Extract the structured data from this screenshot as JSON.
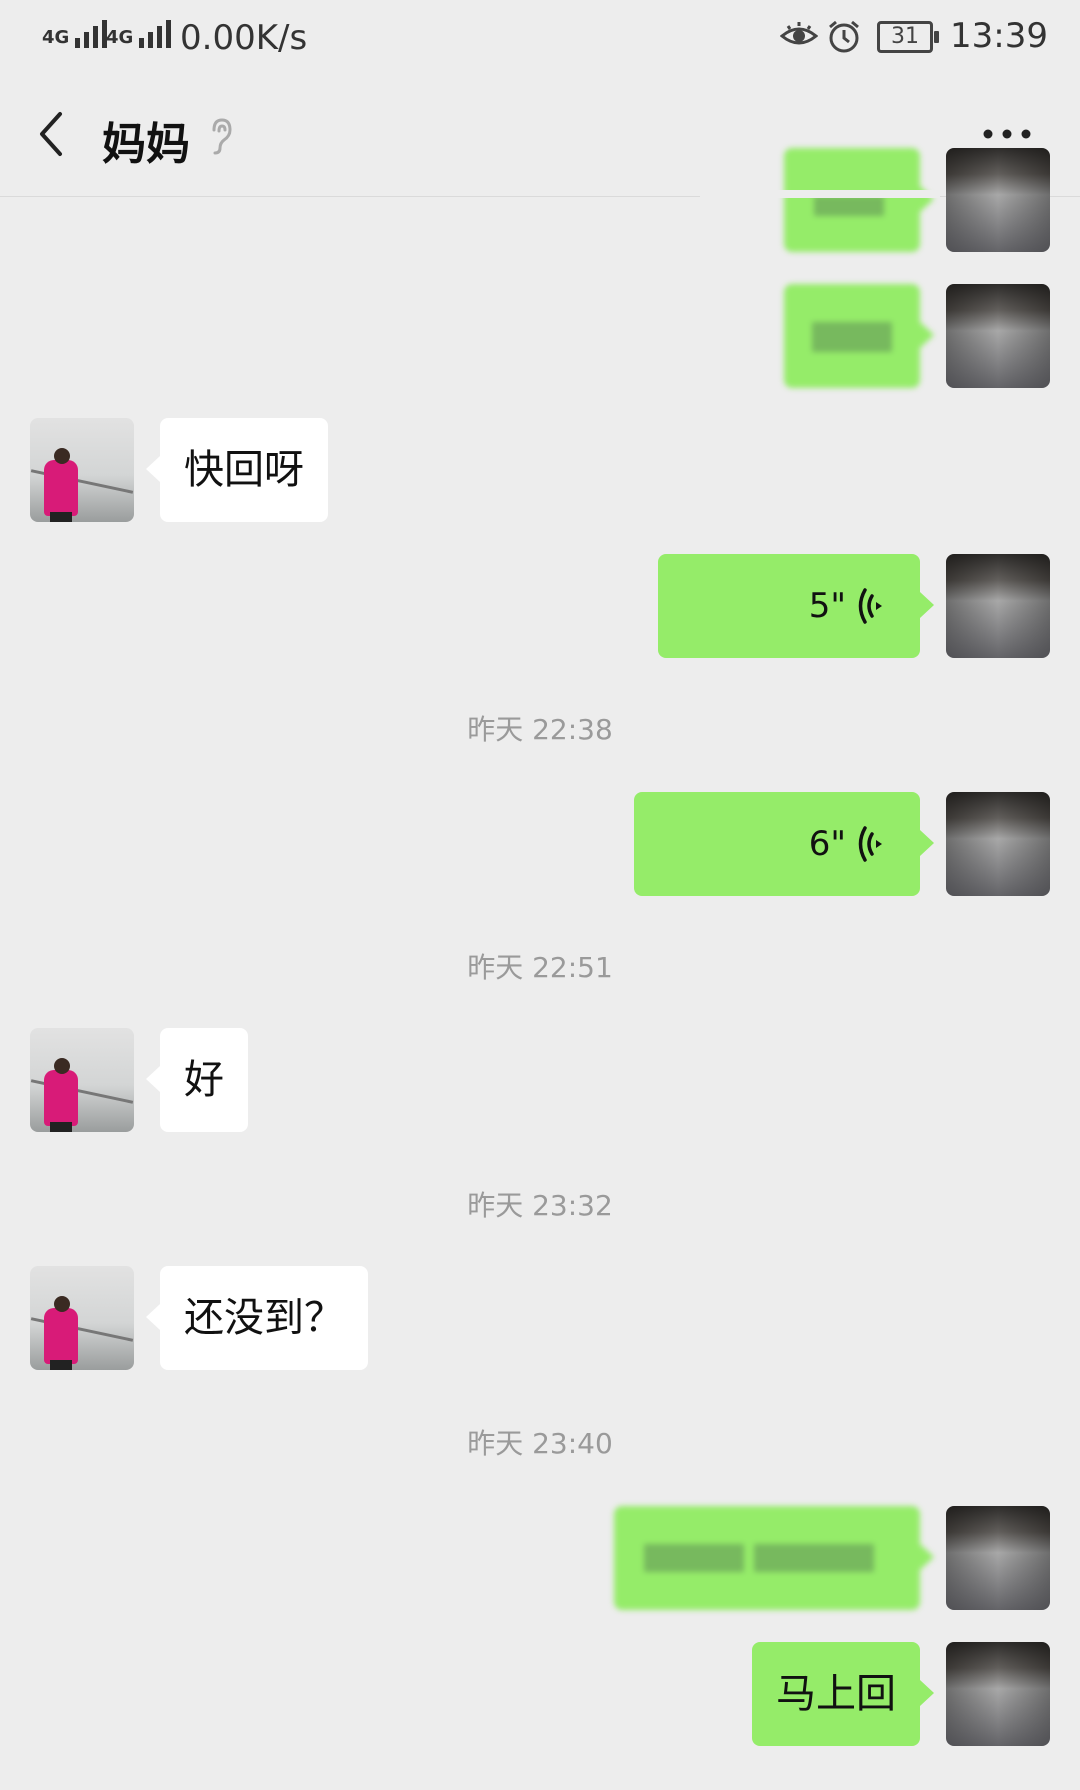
{
  "status_bar": {
    "network1": "4G",
    "network2": "4G",
    "speed": "0.00K/s",
    "battery": "31",
    "time": "13:39"
  },
  "header": {
    "title": "妈妈"
  },
  "messages": {
    "m3": "快回呀",
    "v1": "5\"",
    "ts1": "昨天 22:38",
    "v2": "6\"",
    "ts2": "昨天 22:51",
    "m6": "好",
    "ts3": "昨天 23:32",
    "m7": "还没到？",
    "ts4": "昨天 23:40",
    "m9": "马上回"
  },
  "colors": {
    "background": "#ededed",
    "outgoing_bubble": "#95ec69",
    "incoming_bubble": "#ffffff",
    "timestamp": "#9a9a9a"
  },
  "icons": [
    "signal-icon",
    "eye-icon",
    "alarm-icon",
    "battery-icon",
    "back-arrow-icon",
    "ear-icon",
    "more-icon",
    "voice-wave-icon"
  ]
}
